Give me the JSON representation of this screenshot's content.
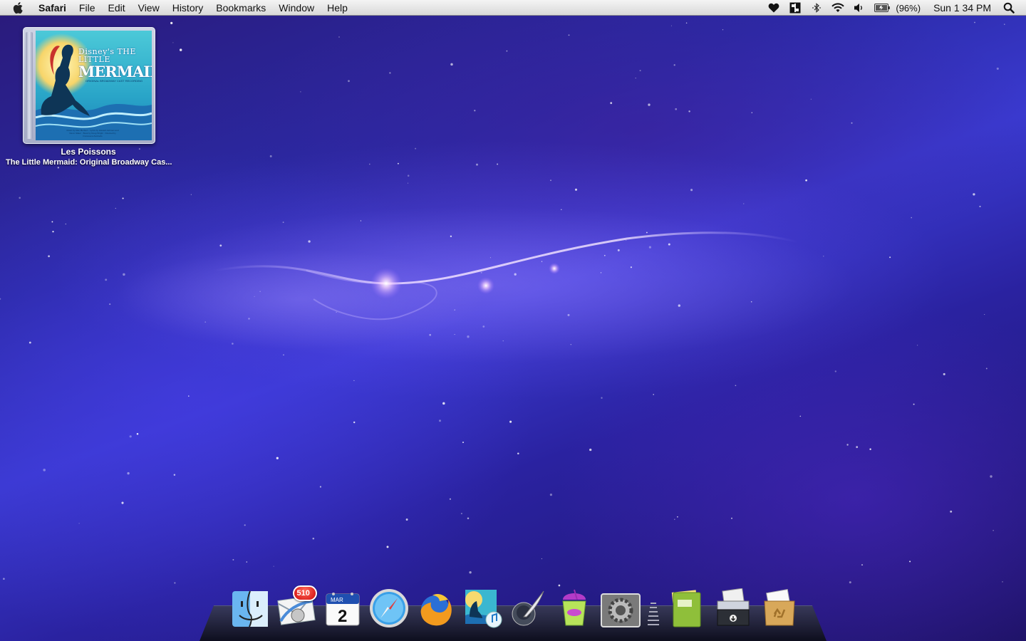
{
  "menubar": {
    "app_name": "Safari",
    "menus": [
      "File",
      "Edit",
      "View",
      "History",
      "Bookmarks",
      "Window",
      "Help"
    ],
    "battery_percent": "(96%)",
    "clock": "Sun 1 34 PM",
    "status_icons": [
      "heart-icon",
      "app-status-icon",
      "bluetooth-icon",
      "wifi-icon",
      "volume-icon",
      "battery-icon",
      "spotlight-icon"
    ]
  },
  "widget": {
    "cover_small_title": "Disney's THE LITTLE",
    "cover_big_title": "MERMAID",
    "cover_subtitle": "ORIGINAL BROADWAY CAST RECORDING",
    "cover_credits": "Music by Alan Menken · Lyrics by Howard Ashman and Glenn Slater · Book by Doug Wright · Directed by Francesca Zambello",
    "track_title": "Les Poissons",
    "album": "The Little Mermaid: Original Broadway Cas..."
  },
  "dock": {
    "items": [
      {
        "name": "finder",
        "icon": "finder-icon"
      },
      {
        "name": "mail",
        "icon": "mail-icon",
        "badge": "510"
      },
      {
        "name": "ical",
        "icon": "calendar-icon",
        "month": "MAR",
        "day": "2"
      },
      {
        "name": "safari",
        "icon": "safari-compass-icon"
      },
      {
        "name": "firefox",
        "icon": "firefox-icon"
      },
      {
        "name": "itunes",
        "icon": "itunes-icon"
      },
      {
        "name": "script-editor",
        "icon": "quill-icon"
      },
      {
        "name": "slurpee",
        "icon": "slurpee-icon"
      },
      {
        "name": "system-preferences",
        "icon": "gear-icon"
      },
      {
        "name": "documents",
        "icon": "folder-icon"
      },
      {
        "name": "downloads",
        "icon": "downloads-tray-icon"
      },
      {
        "name": "trash",
        "icon": "recycle-box-icon"
      }
    ]
  },
  "colors": {
    "menubar": "#e6e6e6",
    "desktop_base": "#2b2aa6",
    "badge": "#d10b0b"
  }
}
